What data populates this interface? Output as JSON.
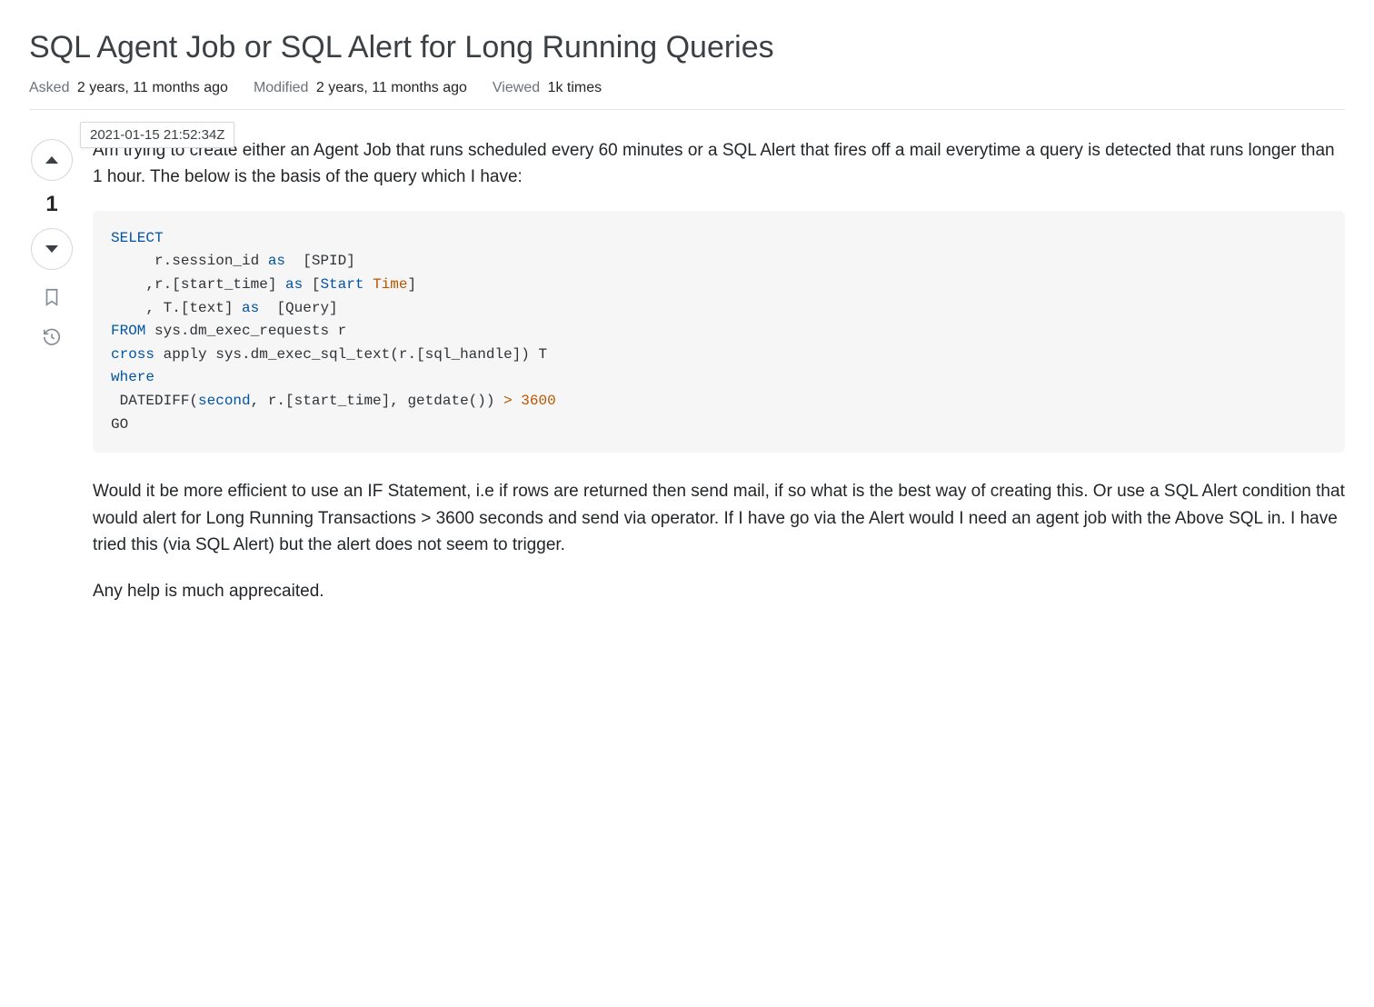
{
  "title": "SQL Agent Job or SQL Alert for Long Running Queries",
  "meta": {
    "asked_label": "Asked",
    "asked_value": "2 years, 11 months ago",
    "modified_label": "Modified",
    "modified_value": "2 years, 11 months ago",
    "viewed_label": "Viewed",
    "viewed_value": "1k times",
    "tooltip": "2021-01-15 21:52:34Z"
  },
  "vote_count": "1",
  "post": {
    "p1": "Am trying to create either an Agent Job that runs scheduled every 60 minutes or a SQL Alert that fires off a mail everytime a query is detected that runs longer than 1 hour. The below is the basis of the query which I have:",
    "p2": "Would it be more efficient to use an IF Statement, i.e if rows are returned then send mail, if so what is the best way of creating this. Or use a SQL Alert condition that would alert for Long Running Transactions > 3600 seconds and send via operator. If I have go via the Alert would I need an agent job with the Above SQL in. I have tried this (via SQL Alert) but the alert does not seem to trigger.",
    "p3": "Any help is much apprecaited."
  },
  "code": {
    "kw_select": "SELECT",
    "l2a": "     r.session_id ",
    "kw_as1": "as",
    "l2b": "  [SPID]",
    "l3a": "    ,r.[start_time] ",
    "kw_as2": "as",
    "l3b": " [",
    "kw_start": "Start",
    "l3c": " ",
    "kw_time": "Time",
    "l3d": "]",
    "l4a": "    , T.[text] ",
    "kw_as3": "as",
    "l4b": "  [Query]",
    "kw_from": "FROM",
    "l5b": " sys.dm_exec_requests r",
    "kw_cross": "cross",
    "l6b": " apply sys.dm_exec_sql_text(r.[sql_handle]) T",
    "kw_where": "where",
    "l8a": " DATEDIFF(",
    "kw_second": "second",
    "l8b": ", r.[start_time], getdate()) ",
    "op_gt": ">",
    "l8c": " ",
    "num_3600": "3600",
    "l9": "GO"
  }
}
